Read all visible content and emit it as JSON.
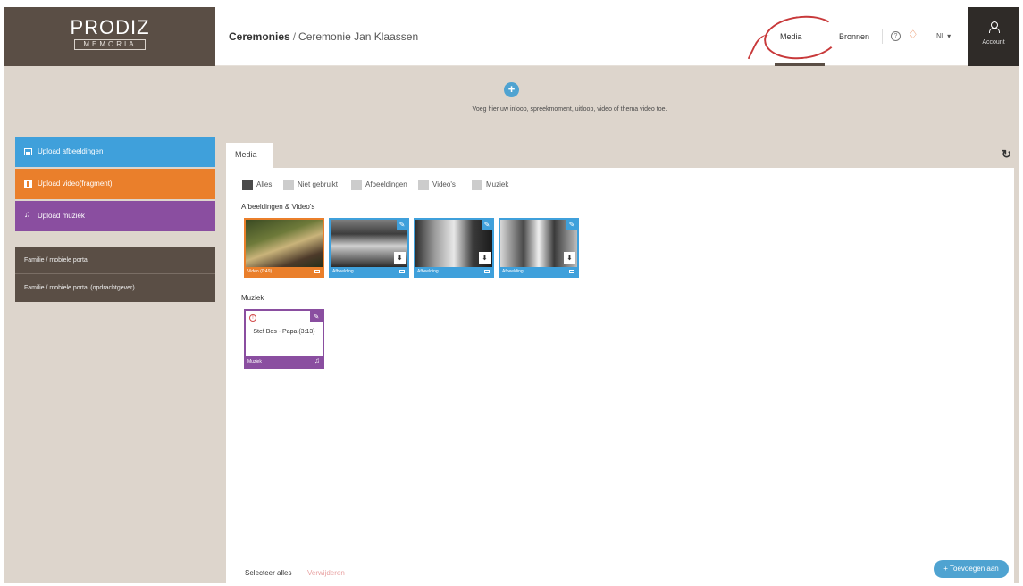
{
  "logo": {
    "title": "PRODIZ",
    "subtitle": "MEMORIA"
  },
  "breadcrumb": {
    "main": "Ceremonies",
    "separator": "/",
    "current": "Ceremonie Jan Klaassen"
  },
  "topnav": {
    "media": "Media",
    "bronnen": "Bronnen",
    "help_icon": "help-icon",
    "notification_icon": "bell-icon",
    "language": "NL",
    "account_label": "Account"
  },
  "banner": {
    "add_label": "+",
    "text": "Voeg hier uw inloop, spreekmoment, uitloop, video of thema video toe."
  },
  "sidebar": {
    "uploads": [
      {
        "label": "Upload afbeeldingen",
        "icon": "image-icon",
        "color": "#3fa0db"
      },
      {
        "label": "Upload video(fragment)",
        "icon": "film-icon",
        "color": "#ea7f2b"
      },
      {
        "label": "Upload muziek",
        "icon": "music-note-icon",
        "color": "#8a4ea0"
      }
    ],
    "portals": [
      {
        "label": "Familie / mobiele portal"
      },
      {
        "label": "Familie / mobiele portal (opdrachtgever)"
      }
    ]
  },
  "main": {
    "tab": "Media",
    "filters": [
      {
        "label": "Alles",
        "active": true
      },
      {
        "label": "Niet gebruikt",
        "active": false
      },
      {
        "label": "Afbeeldingen",
        "active": false
      },
      {
        "label": "Video's",
        "active": false
      },
      {
        "label": "Muziek",
        "active": false
      }
    ],
    "sections": {
      "media": "Afbeeldingen & Video's",
      "music": "Muziek"
    },
    "media_items": [
      {
        "caption": "Video (0:49)",
        "type": "video"
      },
      {
        "caption": "Afbeelding",
        "type": "image"
      },
      {
        "caption": "Afbeelding",
        "type": "image"
      },
      {
        "caption": "Afbeelding",
        "type": "image"
      }
    ],
    "music_items": [
      {
        "title": "Stef Bos - Papa (3:13)",
        "caption": "Muziek"
      }
    ],
    "footer": {
      "select_all": "Selecteer alles",
      "delete": "Verwijderen",
      "add_to": "+ Toevoegen aan"
    }
  },
  "colors": {
    "brand_dark": "#5a4e45",
    "blue": "#3fa0db",
    "orange": "#ea7f2b",
    "purple": "#8a4ea0",
    "annotation_red": "#c8393a"
  }
}
